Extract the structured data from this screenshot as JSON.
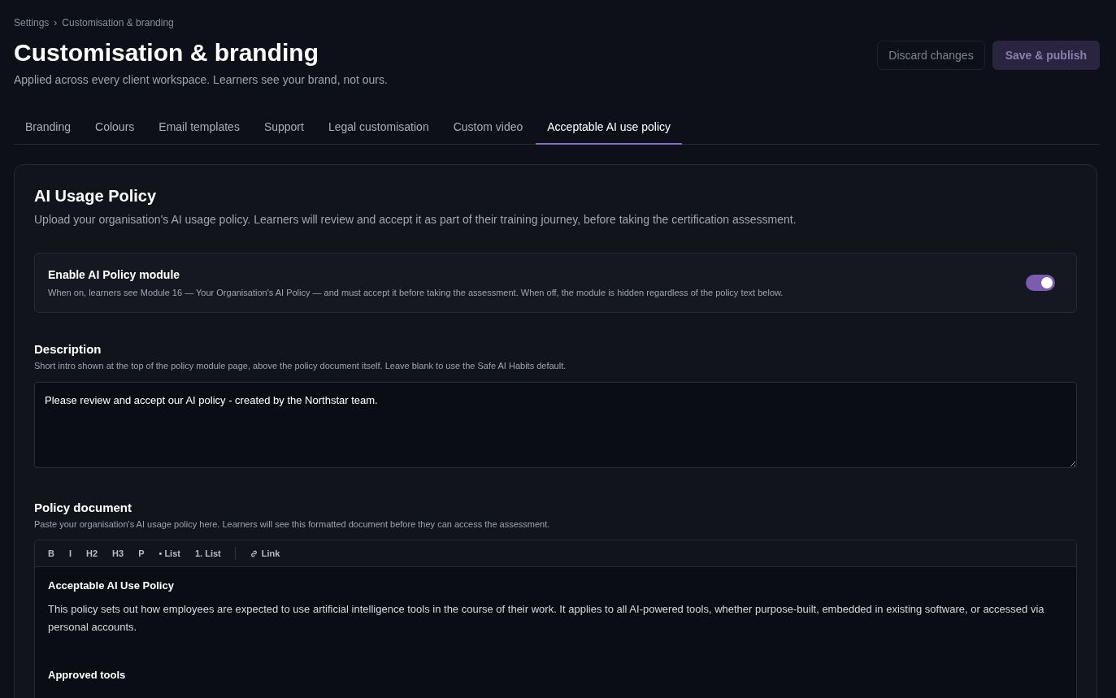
{
  "breadcrumb": [
    "Settings",
    "Customisation & branding"
  ],
  "breadcrumb_separator": "›",
  "title": "Customisation & branding",
  "subtitle": "Applied across every client workspace. Learners see your brand, not ours.",
  "actions": [
    {
      "label": "Discard changes",
      "kind": "secondary",
      "disabled": true
    },
    {
      "label": "Save & publish",
      "kind": "primary",
      "disabled": true
    }
  ],
  "tabs": [
    {
      "label": "Branding",
      "selected": false
    },
    {
      "label": "Colours",
      "selected": false
    },
    {
      "label": "Email templates",
      "selected": false
    },
    {
      "label": "Support",
      "selected": false
    },
    {
      "label": "Legal customisation",
      "selected": false
    },
    {
      "label": "Custom video",
      "selected": false
    },
    {
      "label": "Acceptable AI use policy",
      "selected": true
    }
  ],
  "panel": {
    "title": "AI Usage Policy",
    "intro": "Upload your organisation's AI usage policy. Learners will review and accept it as part of their training journey, before taking the certification assessment.",
    "module_toggle": {
      "label": "Enable AI Policy module",
      "hint": "When on, learners see Module 16 — Your Organisation's AI Policy — and must accept it before taking the assessment. When off, the module is hidden regardless of the policy text below.",
      "on": true
    },
    "description": {
      "label": "Description",
      "hint": "Short intro shown at the top of the policy module page, above the policy document itself. Leave blank to use the Safe AI Habits default.",
      "value": "Please review and accept our AI policy - created by the Northstar team."
    },
    "policy_document": {
      "label": "Policy document",
      "hint": "Paste your organisation's AI usage policy here. Learners will see this formatted document before they can access the assessment.",
      "toolbar": {
        "formats": [
          "B",
          "I",
          "H2",
          "H3",
          "P",
          "• List",
          "1. List"
        ],
        "link": "Link"
      },
      "content": [
        {
          "kind": "heading",
          "text": "Acceptable AI Use Policy"
        },
        {
          "kind": "paragraph",
          "text": "This policy sets out how employees are expected to use artificial intelligence tools in the course of their work. It applies to all AI-powered tools, whether purpose-built, embedded in existing software, or accessed via personal accounts."
        },
        {
          "kind": "blank"
        },
        {
          "kind": "heading",
          "text": "Approved tools"
        }
      ]
    }
  }
}
